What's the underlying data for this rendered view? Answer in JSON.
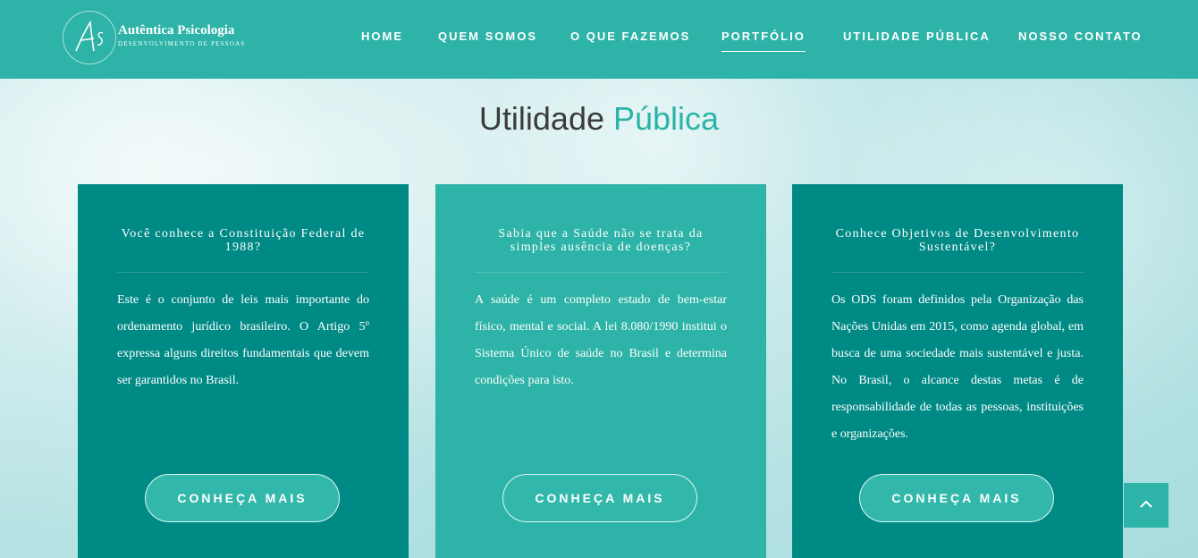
{
  "logo": {
    "name": "Autêntica Psicologia",
    "subtitle": "DESENVOLVIMENTO DE PESSOAS"
  },
  "nav": {
    "items": [
      {
        "label": "HOME"
      },
      {
        "label": "QUEM SOMOS"
      },
      {
        "label": "O QUE FAZEMOS"
      },
      {
        "label": "PORTFÓLIO"
      },
      {
        "label": "UTILIDADE PÚBLICA"
      },
      {
        "label": "NOSSO CONTATO"
      }
    ],
    "active": "PORTFÓLIO"
  },
  "page": {
    "title_main": "Utilidade ",
    "title_accent": "Pública"
  },
  "cards": [
    {
      "title": "Você conhece a Constituição Federal de 1988?",
      "text": "Este é o conjunto de leis mais importante do ordenamento jurídico brasileiro. O Artigo 5º expressa alguns direitos fundamentais que devem ser garantidos no Brasil.",
      "button": "CONHEÇA MAIS"
    },
    {
      "title": "Sabia que a Saúde não se trata da simples ausência de doenças?",
      "text": "A saúde é um completo estado de bem-estar físico, mental e social. A lei 8.080/1990 institui o Sistema Único de saúde no Brasil e determina condições para isto.",
      "button": "CONHEÇA MAIS"
    },
    {
      "title": "Conhece Objetivos de Desenvolvimento Sustentável?",
      "text": "Os ODS foram definidos pela Organização das Nações Unidas em 2015, como agenda global, em busca de uma sociedade mais sustentável e justa. No Brasil, o alcance destas metas é de responsabilidade de todas as pessoas, instituições e organizações.",
      "button": "CONHEÇA MAIS"
    }
  ],
  "icons": {
    "scroll_top": "chevron-up-icon"
  },
  "colors": {
    "primary": "#2db3a7",
    "dark": "#008a85"
  }
}
